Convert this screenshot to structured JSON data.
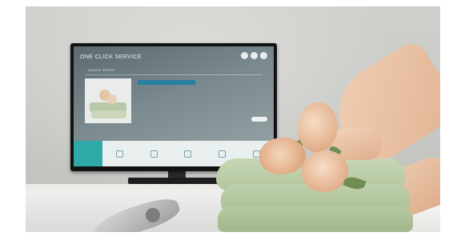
{
  "tv_screen": {
    "title": "ONE CLICK SERVICE",
    "tab": "REQUEST SERVICE",
    "more_label": "...",
    "colors": {
      "accent": "#2fa9a8",
      "selected_row": "#2a7fa0"
    }
  },
  "photo": {
    "subject": "hotel room TV with towels and roses",
    "icons": [
      "circle-icon",
      "circle-icon",
      "circle-icon"
    ]
  }
}
